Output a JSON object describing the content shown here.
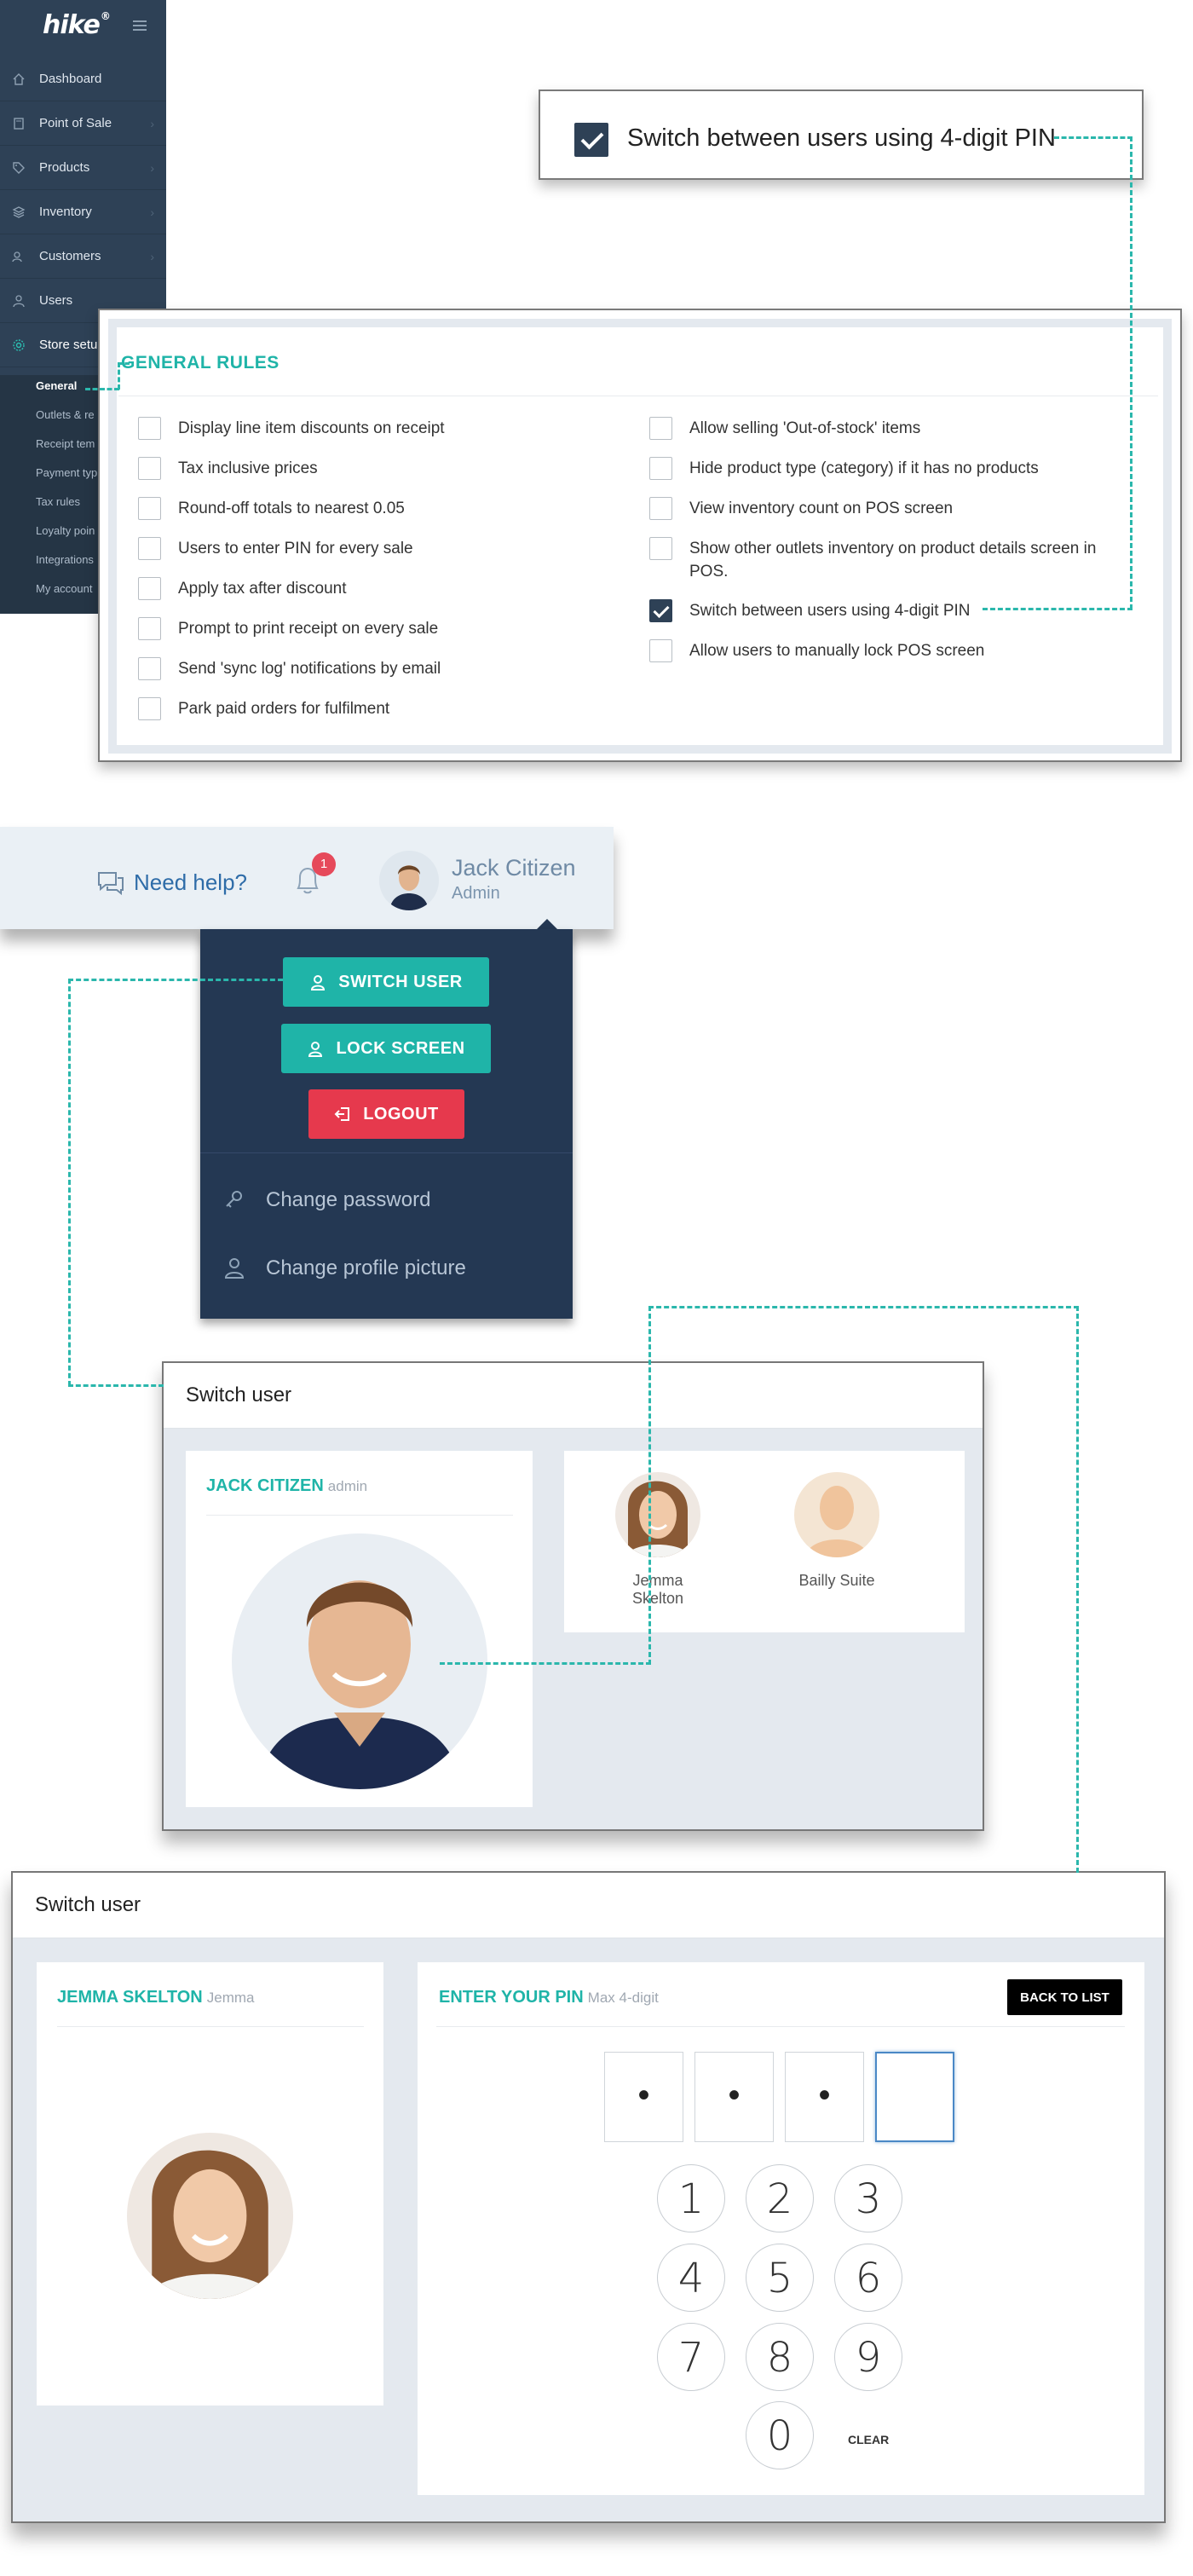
{
  "sidebar": {
    "brand": "hike",
    "brand_mark": "®",
    "items": [
      {
        "label": "Dashboard",
        "icon": "home-icon"
      },
      {
        "label": "Point of Sale",
        "icon": "pos-icon"
      },
      {
        "label": "Products",
        "icon": "tag-icon"
      },
      {
        "label": "Inventory",
        "icon": "layers-icon"
      },
      {
        "label": "Customers",
        "icon": "customers-icon"
      },
      {
        "label": "Users",
        "icon": "user-icon"
      },
      {
        "label": "Store setup",
        "icon": "gear-icon"
      }
    ],
    "store_setup_visible": "Store setu",
    "subitems": [
      "General",
      "Outlets & re",
      "Receipt tem",
      "Payment typ",
      "Tax rules",
      "Loyalty poin",
      "Integrations",
      "My account"
    ]
  },
  "pin_callout": {
    "label": "Switch between users using 4-digit PIN",
    "checked": true
  },
  "general_rules": {
    "title": "GENERAL RULES",
    "left": [
      {
        "label": "Display line item discounts on receipt",
        "checked": false
      },
      {
        "label": "Tax inclusive prices",
        "checked": false
      },
      {
        "label": "Round-off totals to nearest 0.05",
        "checked": false
      },
      {
        "label": "Users to enter PIN for every sale",
        "checked": false
      },
      {
        "label": "Apply tax after discount",
        "checked": false
      },
      {
        "label": "Prompt to print receipt on every sale",
        "checked": false
      },
      {
        "label": "Send 'sync log' notifications by email",
        "checked": false
      },
      {
        "label": "Park paid orders for fulfilment",
        "checked": false
      }
    ],
    "right": [
      {
        "label": "Allow selling 'Out-of-stock' items",
        "checked": false
      },
      {
        "label": "Hide product type (category) if it has no products",
        "checked": false
      },
      {
        "label": "View inventory count on POS screen",
        "checked": false
      },
      {
        "label": "Show other outlets inventory on product details screen in POS.",
        "checked": false
      },
      {
        "label": "Switch between users using 4-digit PIN",
        "checked": true
      },
      {
        "label": "Allow users to manually lock POS screen",
        "checked": false
      }
    ]
  },
  "header": {
    "help": "Need help?",
    "notifications": "1",
    "user_name": "Jack Citizen",
    "user_role": "Admin"
  },
  "user_menu": {
    "switch_user": "SWITCH USER",
    "lock_screen": "LOCK SCREEN",
    "logout": "LOGOUT",
    "change_password": "Change password",
    "change_picture": "Change profile picture",
    "colors": {
      "teal": "#1fb4a8",
      "red": "#e6394d",
      "panel": "#243853"
    }
  },
  "switch_user_list": {
    "title": "Switch user",
    "current_name": "JACK CITIZEN",
    "current_role": "admin",
    "users": [
      {
        "name": "Jemma Skelton"
      },
      {
        "name": "Bailly Suite"
      }
    ]
  },
  "switch_user_pin": {
    "title": "Switch user",
    "user_name": "JEMMA SKELTON",
    "user_short": "Jemma",
    "pin_title": "ENTER YOUR PIN",
    "pin_hint": "Max 4-digit",
    "back": "BACK TO LIST",
    "pin_digits": [
      "•",
      "•",
      "•",
      ""
    ],
    "keys": [
      "1",
      "2",
      "3",
      "4",
      "5",
      "6",
      "7",
      "8",
      "9",
      "0"
    ],
    "clear": "CLEAR"
  }
}
